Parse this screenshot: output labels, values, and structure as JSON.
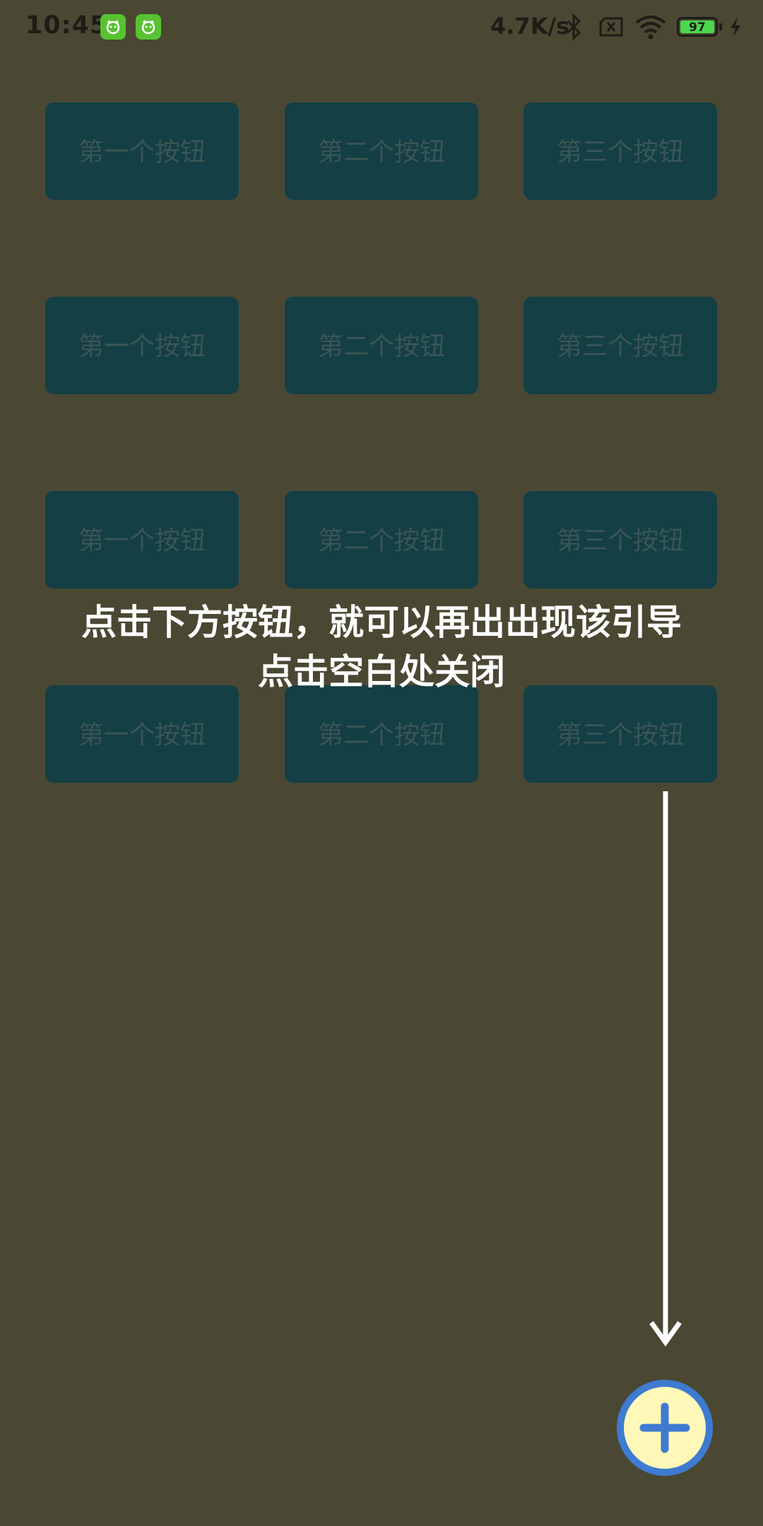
{
  "status_bar": {
    "time": "10:45",
    "net_speed": "4.7K/s",
    "battery_level": "97",
    "app_badges": [
      "notification-app-icon",
      "notification-app-icon"
    ],
    "icons": [
      "bluetooth-icon",
      "sim-off-icon",
      "wifi-icon",
      "battery-icon",
      "charging-icon"
    ]
  },
  "grid": {
    "rows": [
      [
        "第一个按钮",
        "第二个按钮",
        "第三个按钮"
      ],
      [
        "第一个按钮",
        "第二个按钮",
        "第三个按钮"
      ],
      [
        "第一个按钮",
        "第二个按钮",
        "第三个按钮"
      ],
      [
        "第一个按钮",
        "第二个按钮",
        "第三个按钮"
      ]
    ]
  },
  "guide": {
    "line1": "点击下方按钮，就可以再出出现该引导",
    "line2": "点击空白处关闭"
  },
  "fab": {
    "icon": "plus-icon"
  },
  "colors": {
    "overlay_bg": "#4a4833",
    "button_bg": "#133f45",
    "fab_ring": "#3e7bd1",
    "fab_fill": "#fff8b8"
  }
}
